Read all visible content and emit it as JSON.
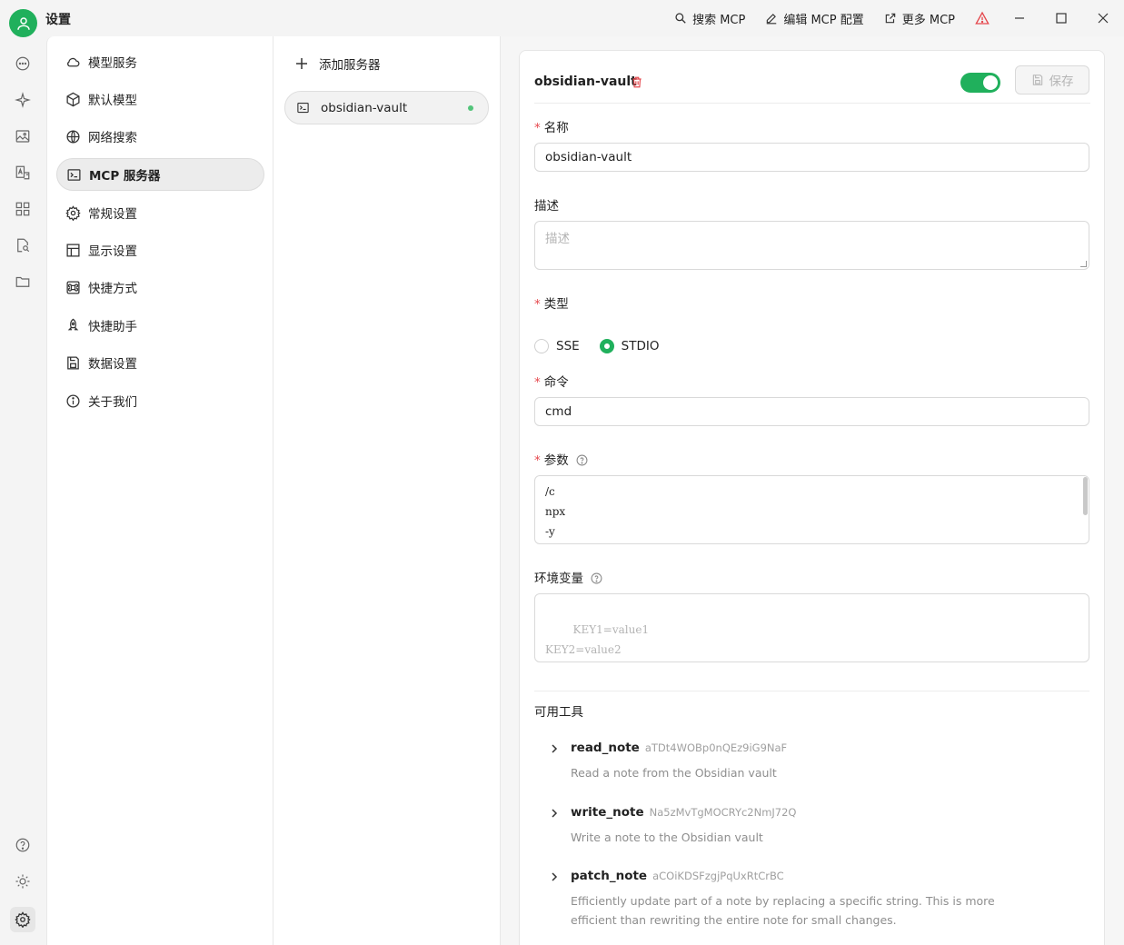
{
  "window": {
    "title": "设置"
  },
  "toolbar": {
    "search_mcp": "搜索 MCP",
    "edit_config": "编辑 MCP 配置",
    "more_mcp": "更多 MCP"
  },
  "nav": {
    "items": [
      {
        "label": "模型服务",
        "icon": "cloud-icon"
      },
      {
        "label": "默认模型",
        "icon": "cube-icon"
      },
      {
        "label": "网络搜索",
        "icon": "globe-icon"
      },
      {
        "label": "MCP 服务器",
        "icon": "terminal-icon",
        "active": true
      },
      {
        "label": "常规设置",
        "icon": "gear-icon"
      },
      {
        "label": "显示设置",
        "icon": "layout-icon"
      },
      {
        "label": "快捷方式",
        "icon": "command-icon"
      },
      {
        "label": "快捷助手",
        "icon": "rocket-icon"
      },
      {
        "label": "数据设置",
        "icon": "save-icon"
      },
      {
        "label": "关于我们",
        "icon": "info-icon"
      }
    ]
  },
  "servers": {
    "add_label": "添加服务器",
    "items": [
      {
        "name": "obsidian-vault",
        "status": "active"
      }
    ]
  },
  "detail": {
    "server_name": "obsidian-vault",
    "enabled": true,
    "save_label": "保存",
    "name_label": "名称",
    "name_value": "obsidian-vault",
    "description_label": "描述",
    "description_placeholder": "描述",
    "type_label": "类型",
    "type_options": [
      "SSE",
      "STDIO"
    ],
    "type_selected": "STDIO",
    "command_label": "命令",
    "command_value": "cmd",
    "args_label": "参数",
    "args_value": "/c\nnpx\n-y",
    "env_label": "环境变量",
    "env_placeholder": "KEY1=value1\nKEY2=value2",
    "tools_label": "可用工具",
    "tools": [
      {
        "name": "read_note",
        "id": "aTDt4WOBp0nQEz9iG9NaF",
        "description": "Read a note from the Obsidian vault"
      },
      {
        "name": "write_note",
        "id": "Na5zMvTgMOCRYc2NmJ72Q",
        "description": "Write a note to the Obsidian vault"
      },
      {
        "name": "patch_note",
        "id": "aCOiKDSFzgjPqUxRtCrBC",
        "description": "Efficiently update part of a note by replacing a specific string. This is more efficient than rewriting the entire note for small changes."
      }
    ]
  },
  "colors": {
    "accent": "#20b05c",
    "danger": "#e5484d"
  }
}
